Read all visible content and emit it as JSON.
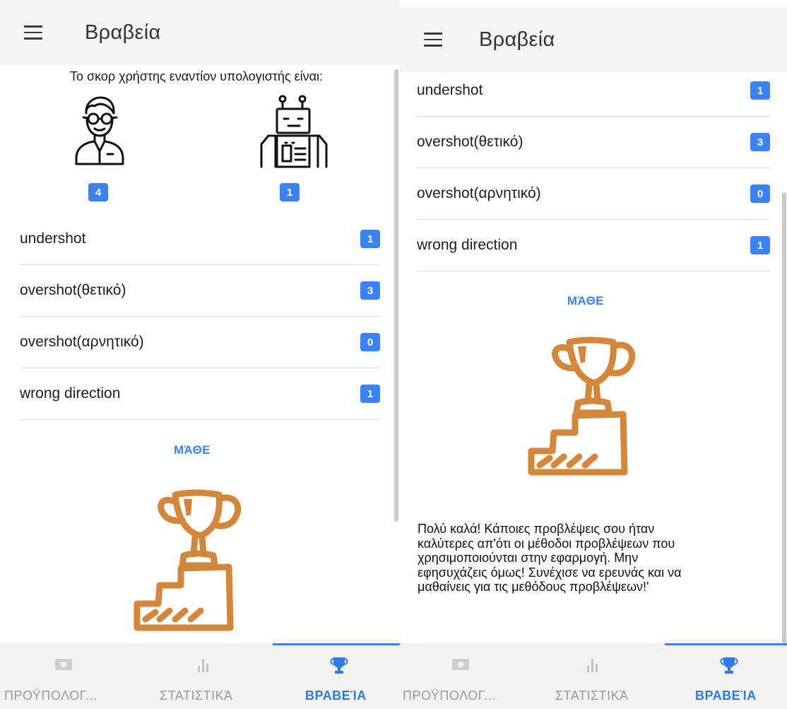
{
  "screens": [
    {
      "appbar": {
        "title": "Βραβεία"
      },
      "score": {
        "heading": "Το σκορ χρήστης εναντίον υπολογιστής είναι:",
        "user_icon": "user-with-glasses-icon",
        "user_score": "4",
        "computer_icon": "robot-icon",
        "computer_score": "1"
      },
      "stats": [
        {
          "label": "undershot",
          "count": "1"
        },
        {
          "label": "overshot(θετικό)",
          "count": "3"
        },
        {
          "label": "overshot(αρνητικό)",
          "count": "0"
        },
        {
          "label": "wrong direction",
          "count": "1"
        }
      ],
      "learn_label": "ΜΆΘΕ",
      "trophy_icon": "trophy-on-podium-icon"
    },
    {
      "appbar": {
        "title": "Βραβεία"
      },
      "stats": [
        {
          "label": "undershot",
          "count": "1"
        },
        {
          "label": "overshot(θετικό)",
          "count": "3"
        },
        {
          "label": "overshot(αρνητικό)",
          "count": "0"
        },
        {
          "label": "wrong direction",
          "count": "1"
        }
      ],
      "learn_label": "ΜΆΘΕ",
      "trophy_icon": "trophy-on-podium-icon",
      "message_lines": [
        "Πολύ καλά! Κάποιες προβλέψεις σου ήταν",
        "καλύτερες απ'ότι οι μέθοδοι προβλέψεων που",
        "χρησιμοποιούνται στην εφαρμογή. Μην",
        "εφησυχάζεις όμως! Συνέχισε να ερευνάς και να",
        "μαθαίνεις για τις μεθόδους προβλέψεων!'"
      ]
    }
  ],
  "bottom_nav": [
    {
      "label": "ΠΡΟΫΠΟΛΟΓ...",
      "icon": "money-icon",
      "active": false
    },
    {
      "label": "ΣΤΑΤΙΣΤΙΚΆ",
      "icon": "bar-chart-icon",
      "active": false
    },
    {
      "label": "ΒΡΑΒΕΊΑ",
      "icon": "trophy-icon",
      "active": true
    }
  ],
  "colors": {
    "accent": "#3b82f6",
    "trophy": "#d4863a",
    "appbar_bg": "#f4f4f4",
    "nav_inactive": "#9a9a9a"
  }
}
